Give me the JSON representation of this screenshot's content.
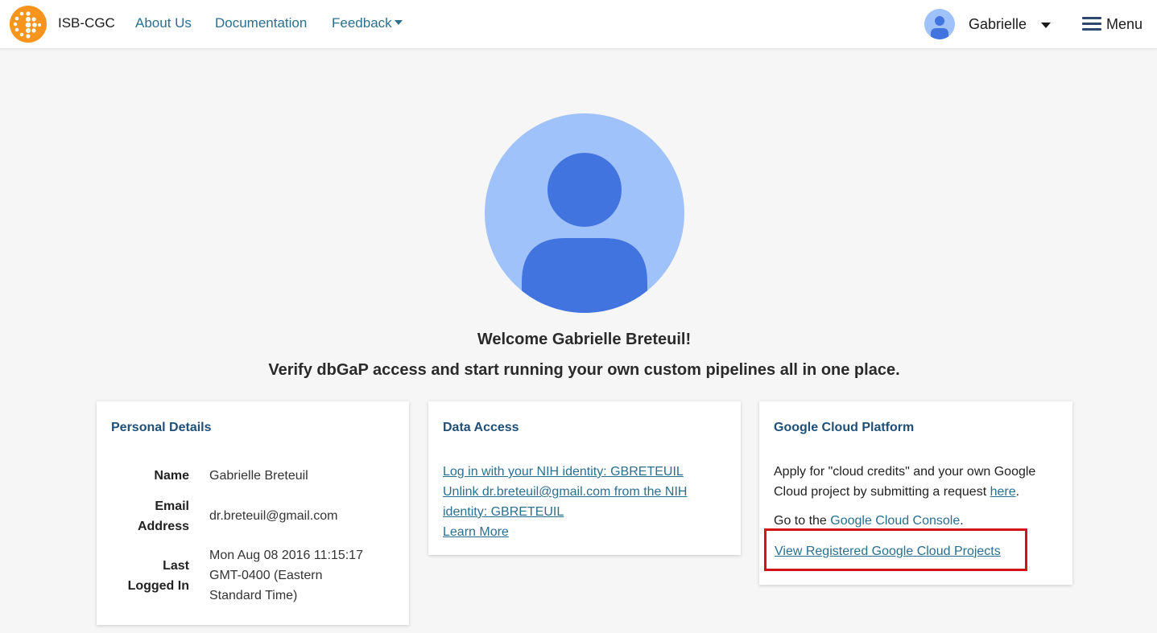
{
  "nav": {
    "brand": "ISB-CGC",
    "about": "About Us",
    "documentation": "Documentation",
    "feedback": "Feedback",
    "user_name": "Gabrielle",
    "menu": "Menu"
  },
  "hero": {
    "welcome": "Welcome Gabrielle Breteuil!",
    "tagline": "Verify dbGaP access and start running your own custom pipelines all in one place."
  },
  "personal": {
    "title": "Personal Details",
    "name_label": "Name",
    "name_value": "Gabrielle Breteuil",
    "email_label_1": "Email",
    "email_label_2": "Address",
    "email_value": "dr.breteuil@gmail.com",
    "last_label_1": "Last",
    "last_label_2": "Logged In",
    "last_value_1": "Mon Aug 08 2016 11:15:17",
    "last_value_2": "GMT-0400 (Eastern",
    "last_value_3": "Standard Time)"
  },
  "data_access": {
    "title": "Data Access",
    "login_link": "Log in with your NIH identity: GBRETEUIL",
    "unlink_line1": "Unlink dr.breteuil@gmail.com from the NIH",
    "unlink_line2": "identity: GBRETEUIL",
    "learn_more": "Learn More"
  },
  "gcp": {
    "title": "Google Cloud Platform",
    "apply_line1": "Apply for \"cloud credits\" and your own Google",
    "apply_line2_pre": "Cloud project by submitting a request ",
    "here": "here",
    "period": ".",
    "goto_pre": "Go to the ",
    "console": "Google Cloud Console",
    "view_projects": "View Registered Google Cloud Projects"
  },
  "colors": {
    "accent": "#2a6f8e",
    "brand_orange": "#f7941d",
    "highlight": "#d4121a",
    "avatar_light": "#a0c2fb",
    "avatar_dark": "#4274e0"
  }
}
